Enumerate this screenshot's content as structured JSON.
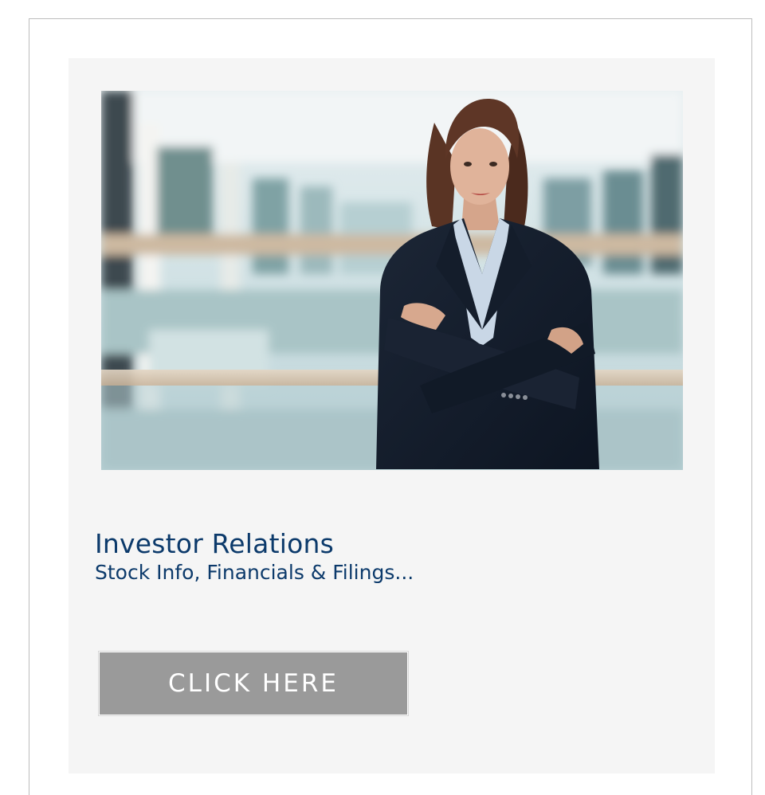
{
  "card": {
    "title": "Investor Relations",
    "subtitle": "Stock Info, Financials & Filings...",
    "button_label": "CLICK HERE"
  },
  "colors": {
    "title": "#0c3a6b",
    "button_bg": "#9a9a9a",
    "card_bg": "#f5f5f5"
  }
}
